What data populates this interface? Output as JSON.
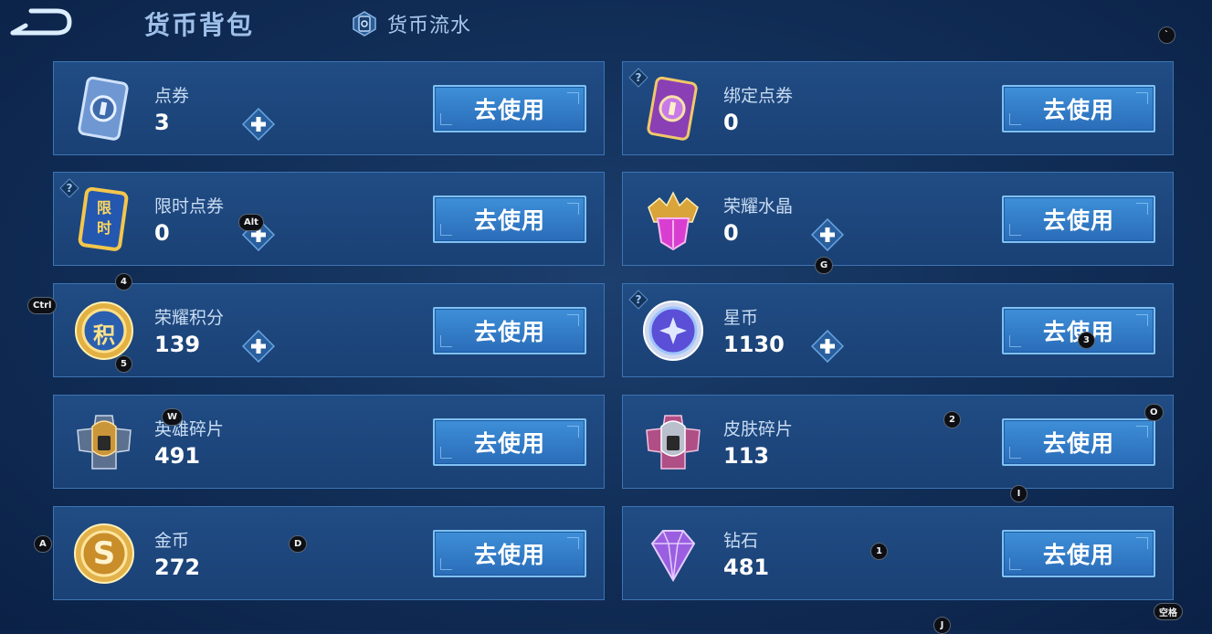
{
  "header": {
    "title": "货币背包",
    "history_label": "货币流水"
  },
  "cards": [
    {
      "name": "点券",
      "amount": "3",
      "use_label": "去使用"
    },
    {
      "name": "绑定点券",
      "amount": "0",
      "use_label": "去使用"
    },
    {
      "name": "限时点券",
      "amount": "0",
      "use_label": "去使用",
      "icon_text": "限时"
    },
    {
      "name": "荣耀水晶",
      "amount": "0",
      "use_label": "去使用"
    },
    {
      "name": "荣耀积分",
      "amount": "139",
      "use_label": "去使用",
      "icon_text": "积"
    },
    {
      "name": "星币",
      "amount": "1130",
      "use_label": "去使用"
    },
    {
      "name": "英雄碎片",
      "amount": "491",
      "use_label": "去使用"
    },
    {
      "name": "皮肤碎片",
      "amount": "113",
      "use_label": "去使用"
    },
    {
      "name": "金币",
      "amount": "272",
      "use_label": "去使用",
      "icon_text": "S"
    },
    {
      "name": "钻石",
      "amount": "481",
      "use_label": "去使用"
    }
  ],
  "hotkeys": {
    "backtick": "`",
    "alt": "Alt",
    "four": "4",
    "ctrl": "Ctrl",
    "g": "G",
    "five": "5",
    "three": "3",
    "w": "W",
    "two": "2",
    "o": "O",
    "i": "I",
    "a": "A",
    "d": "D",
    "one": "1",
    "space": "空格",
    "j": "J"
  },
  "colors": {
    "background": "#12305a",
    "card": "#1d4679",
    "card_border": "#3d74b2",
    "button": "#3380cc",
    "button_border": "#7fc1f4"
  }
}
